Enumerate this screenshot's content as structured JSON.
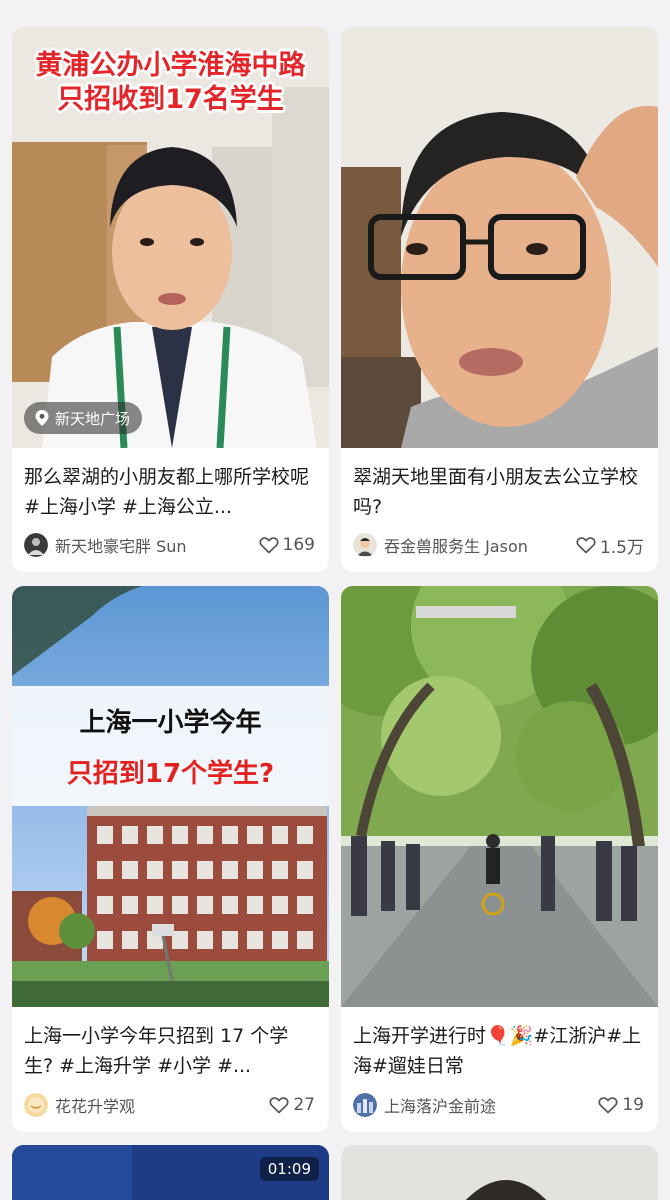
{
  "cards": [
    {
      "overlay_line1": "黄浦公办小学淮海中路",
      "overlay_line2": "只招收到17名学生",
      "location": "新天地广场",
      "title": "那么翠湖的小朋友都上哪所学校呢#上海小学 #上海公立...",
      "author": "新天地豪宅胖 Sun",
      "likes": "169"
    },
    {
      "title": "翠湖天地里面有小朋友去公立学校吗?",
      "author": "吞金兽服务生 Jason",
      "likes": "1.5万"
    },
    {
      "overlay_line1": "上海一小学今年",
      "overlay_line2": "只招到17个学生?",
      "title": "上海一小学今年只招到 17 个学生? #上海升学 #小学 #...",
      "author": "花花升学观",
      "likes": "27"
    },
    {
      "title": "上海开学进行时🎈🎉#江浙沪#上海#遛娃日常",
      "author": "上海落沪金前途",
      "likes": "19"
    },
    {
      "duration": "01:09"
    },
    {}
  ],
  "icons": {
    "location": "location-pin-icon",
    "like": "heart-outline-icon"
  },
  "colors": {
    "background": "#f2f2f4",
    "card": "#ffffff",
    "overlay_red": "#e4262b"
  }
}
